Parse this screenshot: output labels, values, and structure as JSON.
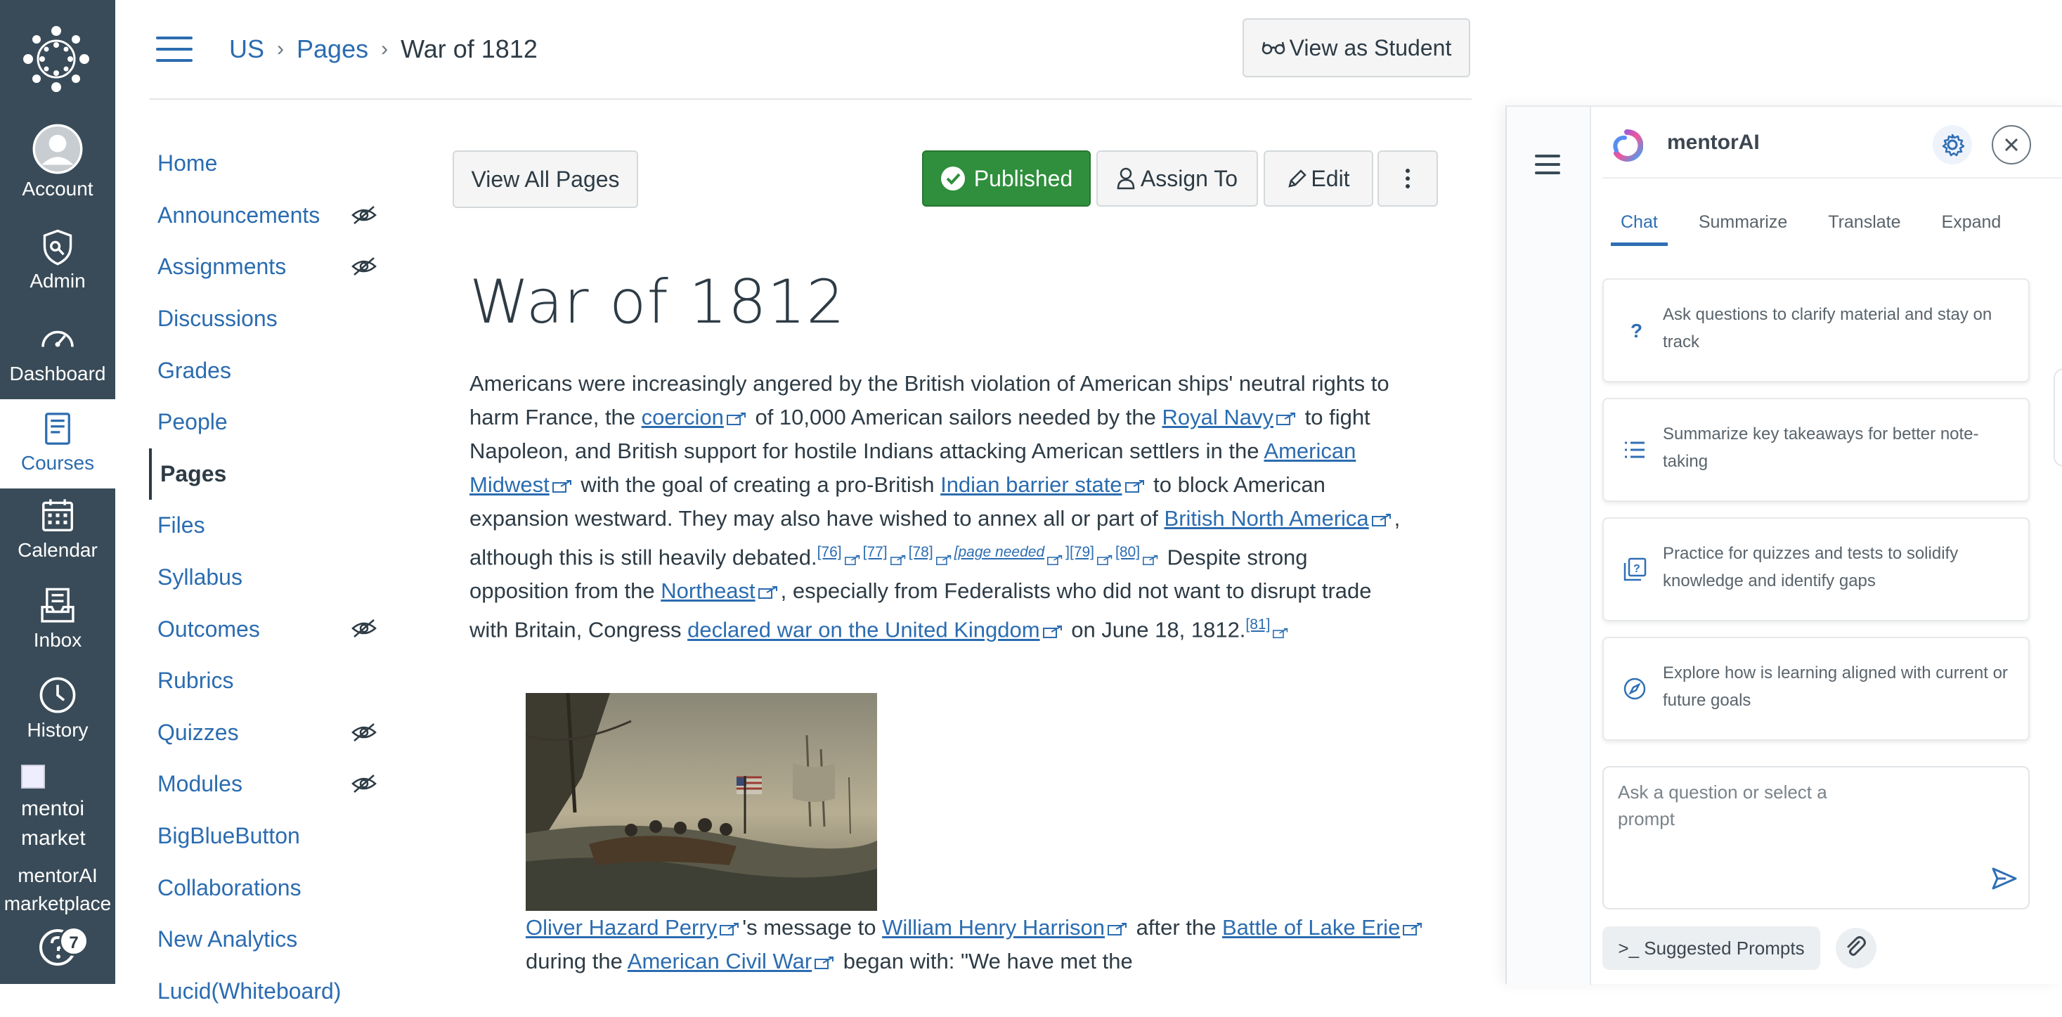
{
  "global_nav": {
    "items": [
      {
        "label": "Account",
        "icon": "account-icon"
      },
      {
        "label": "Admin",
        "icon": "admin-shield-icon"
      },
      {
        "label": "Dashboard",
        "icon": "dashboard-gauge-icon"
      },
      {
        "label": "Courses",
        "icon": "courses-book-icon"
      },
      {
        "label": "Calendar",
        "icon": "calendar-icon"
      },
      {
        "label": "Inbox",
        "icon": "inbox-icon"
      },
      {
        "label": "History",
        "icon": "history-clock-icon"
      }
    ],
    "marketplace_alt": "mentoi market",
    "marketplace_label": "mentorAI marketplace",
    "help_badge": "7",
    "colors": {
      "bg": "#394b58",
      "active_bg": "#ffffff",
      "active_fg": "#2b6cb0"
    }
  },
  "header": {
    "breadcrumbs": [
      "US",
      "Pages",
      "War of 1812"
    ],
    "view_as_student": "View as Student"
  },
  "course_nav": {
    "items": [
      {
        "label": "Home",
        "hidden": false
      },
      {
        "label": "Announcements",
        "hidden": true
      },
      {
        "label": "Assignments",
        "hidden": true
      },
      {
        "label": "Discussions",
        "hidden": false
      },
      {
        "label": "Grades",
        "hidden": false
      },
      {
        "label": "People",
        "hidden": false
      },
      {
        "label": "Pages",
        "hidden": false,
        "active": true
      },
      {
        "label": "Files",
        "hidden": false
      },
      {
        "label": "Syllabus",
        "hidden": false
      },
      {
        "label": "Outcomes",
        "hidden": true
      },
      {
        "label": "Rubrics",
        "hidden": false
      },
      {
        "label": "Quizzes",
        "hidden": true
      },
      {
        "label": "Modules",
        "hidden": true
      },
      {
        "label": "BigBlueButton",
        "hidden": false
      },
      {
        "label": "Collaborations",
        "hidden": false
      },
      {
        "label": "New Analytics",
        "hidden": false
      },
      {
        "label": "Lucid(Whiteboard)",
        "hidden": false
      }
    ]
  },
  "toolbar": {
    "view_all_pages": "View All Pages",
    "published": "Published",
    "assign_to": "Assign To",
    "edit": "Edit",
    "published_color": "#2f8f3c"
  },
  "page": {
    "title": "War of 1812",
    "p": {
      "t1": "Americans were increasingly angered by the British violation of American ships' neutral rights to harm France, the ",
      "l1": "coercion",
      "t2": " of 10,000 American sailors needed by the ",
      "l2": "Royal Navy",
      "t3": " to fight Napoleon, and British support for hostile Indians attacking American settlers in the ",
      "l3": "American Midwest",
      "t4": " with the goal of creating a pro-British ",
      "l4": "Indian barrier state",
      "t5": " to block American expansion westward. They may also have wished to annex all or part of ",
      "l5": "British North America",
      "t6": ", although this is still heavily debated.",
      "r76": "[76]",
      "r77": "[77]",
      "r78": "[78]",
      "rpn": "[page needed",
      "rpn_close": "]",
      "r79": "[79]",
      "r80": "[80]",
      "t7": " Despite strong opposition from the ",
      "l6": "Northeast",
      "t8": ", especially from Federalists who did not want to disrupt trade with Britain, Congress ",
      "l7": "declared war on the United Kingdom",
      "t9": " on June 18, 1812.",
      "r81": "[81]"
    },
    "caption": {
      "l1": "Oliver Hazard Perry",
      "t1": "'s message to ",
      "l2": "William Henry Harrison",
      "t2": " after the ",
      "l3": "Battle of Lake Erie",
      "t3": " during the ",
      "l4": "American Civil War",
      "t4": " began with: \"We have met the"
    }
  },
  "mentor": {
    "title": "mentorAI",
    "tabs": [
      "Chat",
      "Summarize",
      "Translate",
      "Expand"
    ],
    "active_tab": "Chat",
    "cards": [
      {
        "icon": "question-icon",
        "text": "Ask questions to clarify material and stay on track"
      },
      {
        "icon": "list-icon",
        "text": "Summarize key takeaways for better note-taking"
      },
      {
        "icon": "quiz-icon",
        "text": "Practice for quizzes and tests to solidify knowledge and identify gaps"
      },
      {
        "icon": "compass-icon",
        "text": "Explore how is learning aligned with current or future goals"
      }
    ],
    "input_placeholder": "Ask a question or select a prompt",
    "suggested_prompts": ">_ Suggested Prompts",
    "accent": "#2f6fb5"
  }
}
